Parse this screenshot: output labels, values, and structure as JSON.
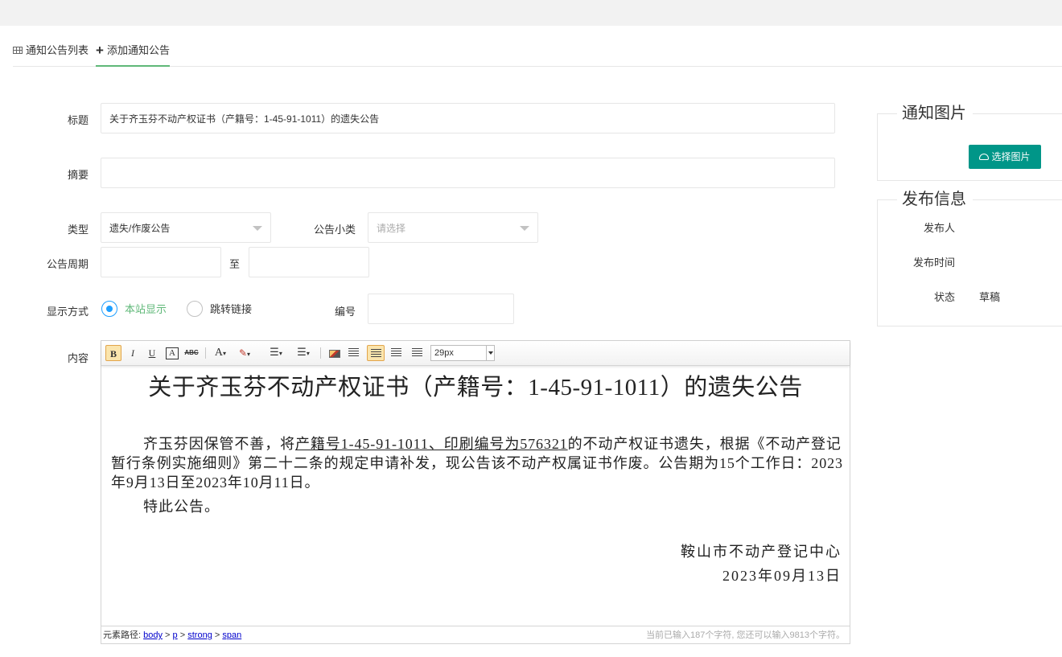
{
  "tabs": {
    "list_label": "通知公告列表",
    "add_label": "添加通知公告"
  },
  "form": {
    "title_label": "标题",
    "title_value": "关于齐玉芬不动产权证书（产籍号：1-45-91-1011）的遗失公告",
    "summary_label": "摘要",
    "summary_value": "",
    "type_label": "类型",
    "type_value": "遗失/作废公告",
    "subtype_label": "公告小类",
    "subtype_placeholder": "请选择",
    "period_label": "公告周期",
    "period_to": "至",
    "display_label": "显示方式",
    "display_option_site": "本站显示",
    "display_option_link": "跳转链接",
    "number_label": "编号",
    "content_label": "内容"
  },
  "editor": {
    "font_size": "29px",
    "toolbar_letters": {
      "bold": "B",
      "italic": "I",
      "underline": "U",
      "border": "A",
      "strike": "ABC",
      "font_color": "A"
    },
    "doc_title": "关于齐玉芬不动产权证书（产籍号：1-45-91-1011）的遗失公告",
    "para_before": "齐玉芬因保管不善，将",
    "para_underlined": "产籍号1-45-91-1011、印刷编号为576321",
    "para_after": "的不动产权证书遗失，根据《不动产登记暂行条例实施细则》第二十二条的规定申请补发，现公告该不动产权属证书作废。公告期为15个工作日：2023年9月13日至2023年10月11日。",
    "para2": "特此公告。",
    "sign_org": "鞍山市不动产登记中心",
    "sign_date": "2023年09月13日",
    "path_label": "元素路径:",
    "path_body": "body",
    "path_p": "p",
    "path_strong": "strong",
    "path_span": "span",
    "path_sep": ">",
    "char_count": "当前已输入187个字符, 您还可以输入9813个字符。"
  },
  "sidebar": {
    "image_legend": "通知图片",
    "choose_image": "选择图片",
    "publish_legend": "发布信息",
    "publisher_label": "发布人",
    "publish_time_label": "发布时间",
    "status_label": "状态",
    "status_value": "草稿"
  },
  "colors": {
    "accent_green": "#009688",
    "tab_underline": "#5fb878",
    "radio_blue": "#1e9fff"
  },
  "icons": {
    "list_tab": "table-icon",
    "add_tab": "plus-icon",
    "choose_image": "cloud-upload-icon"
  }
}
